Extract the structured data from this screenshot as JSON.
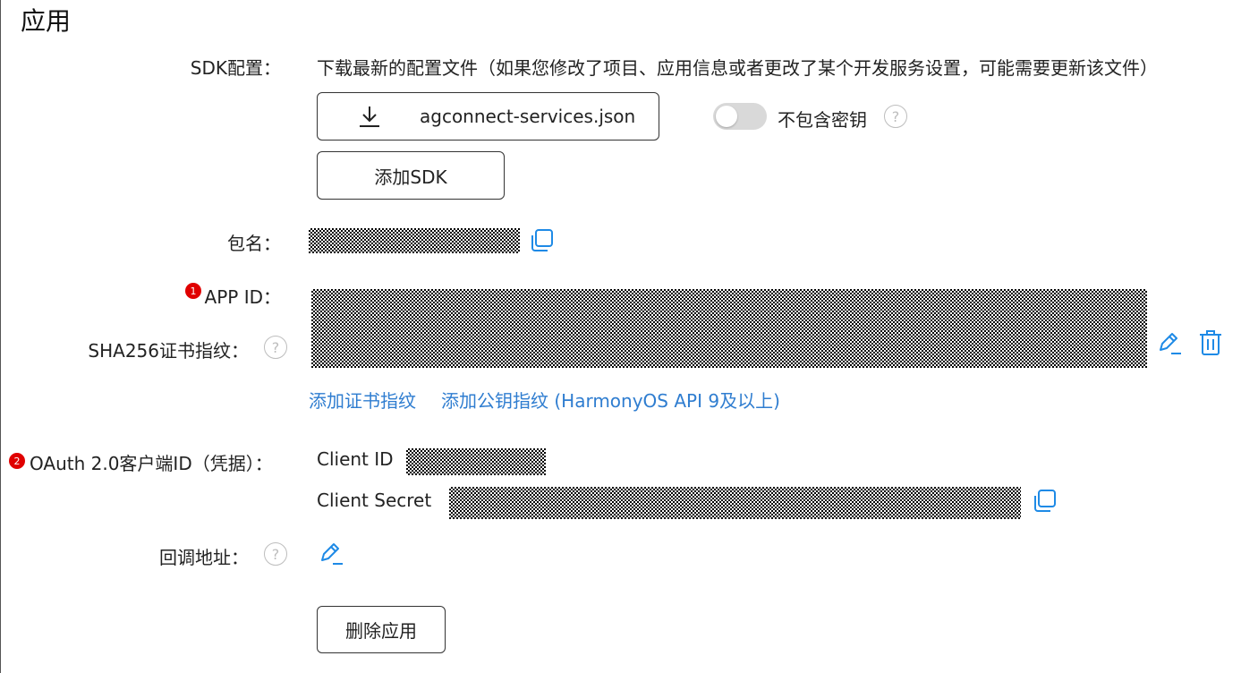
{
  "page_title": "应用",
  "sdk": {
    "label": "SDK配置：",
    "description": "下载最新的配置文件（如果您修改了项目、应用信息或者更改了某个开发服务设置，可能需要更新该文件）",
    "download_file": "agconnect-services.json",
    "toggle_label": "不包含密钥",
    "add_sdk_button": "添加SDK"
  },
  "package": {
    "label": "包名："
  },
  "app_id": {
    "badge": "1",
    "label": "APP ID："
  },
  "sha256": {
    "label": "SHA256证书指纹："
  },
  "links": {
    "add_cert_fingerprint": "添加证书指纹",
    "add_public_key_fingerprint": "添加公钥指纹 (HarmonyOS API 9及以上)"
  },
  "oauth": {
    "badge": "2",
    "label": "OAuth 2.0客户端ID（凭据）：",
    "client_id_label": "Client ID",
    "client_secret_label": "Client Secret"
  },
  "callback": {
    "label": "回调地址："
  },
  "delete_app_button": "删除应用",
  "colors": {
    "link": "#2f7dd0",
    "icon_blue": "#1e8ae6",
    "badge_red": "#e00000",
    "toggle_off": "#d9d9d9"
  }
}
